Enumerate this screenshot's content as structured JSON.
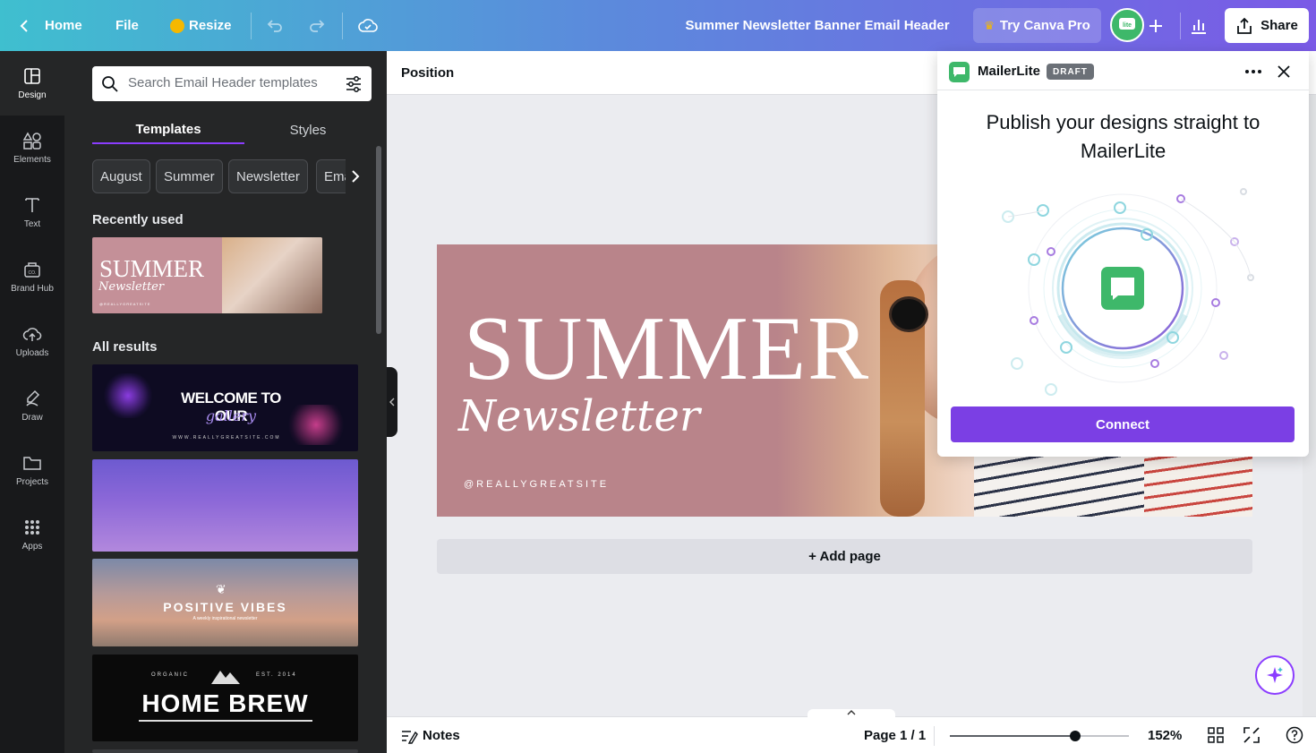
{
  "topbar": {
    "home": "Home",
    "file": "File",
    "resize": "Resize",
    "doc_title": "Summer Newsletter Banner Email Header",
    "pro": "Try Canva Pro",
    "share": "Share"
  },
  "rail": [
    {
      "label": "Design",
      "icon": "design-icon"
    },
    {
      "label": "Elements",
      "icon": "elements-icon"
    },
    {
      "label": "Text",
      "icon": "text-icon"
    },
    {
      "label": "Brand Hub",
      "icon": "brand-hub-icon"
    },
    {
      "label": "Uploads",
      "icon": "uploads-icon"
    },
    {
      "label": "Draw",
      "icon": "draw-icon"
    },
    {
      "label": "Projects",
      "icon": "folder-icon"
    },
    {
      "label": "Apps",
      "icon": "apps-grid-icon"
    }
  ],
  "panel": {
    "search_placeholder": "Search Email Header templates",
    "tabs": [
      "Templates",
      "Styles"
    ],
    "chips": [
      "August",
      "Summer",
      "Newsletter",
      "Ema"
    ],
    "recently_used": "Recently used",
    "all_results": "All results",
    "thumbs": {
      "recent": {
        "title": "SUMMER",
        "script": "Newsletter",
        "handle": "@REALLYGREATSITE"
      },
      "gallery": {
        "title": "WELCOME TO OUR",
        "script": "gallery",
        "url": "WWW.REALLYGREATSITE.COM"
      },
      "positive": {
        "title": "POSITIVE VIBES",
        "sub": "A weekly inspirational newsletter"
      },
      "brew": {
        "left": "ORGANIC",
        "right": "EST. 2014",
        "title": "HOME BREW"
      }
    }
  },
  "canvas": {
    "position_label": "Position",
    "title": "SUMMER",
    "script": "Newsletter",
    "handle": "@REALLYGREATSITE",
    "add_page": "+ Add page"
  },
  "bottombar": {
    "notes": "Notes",
    "page": "Page 1 / 1",
    "zoom": "152%",
    "zoom_level": 0.7
  },
  "popup": {
    "app_name": "MailerLite",
    "badge": "DRAFT",
    "heading": "Publish your designs straight to MailerLite",
    "connect": "Connect"
  },
  "colors": {
    "accent": "#8b3dff",
    "connect": "#7b3fe4",
    "mailerlite_green": "#3eb86a",
    "canvas_bg": "#b9848a"
  }
}
